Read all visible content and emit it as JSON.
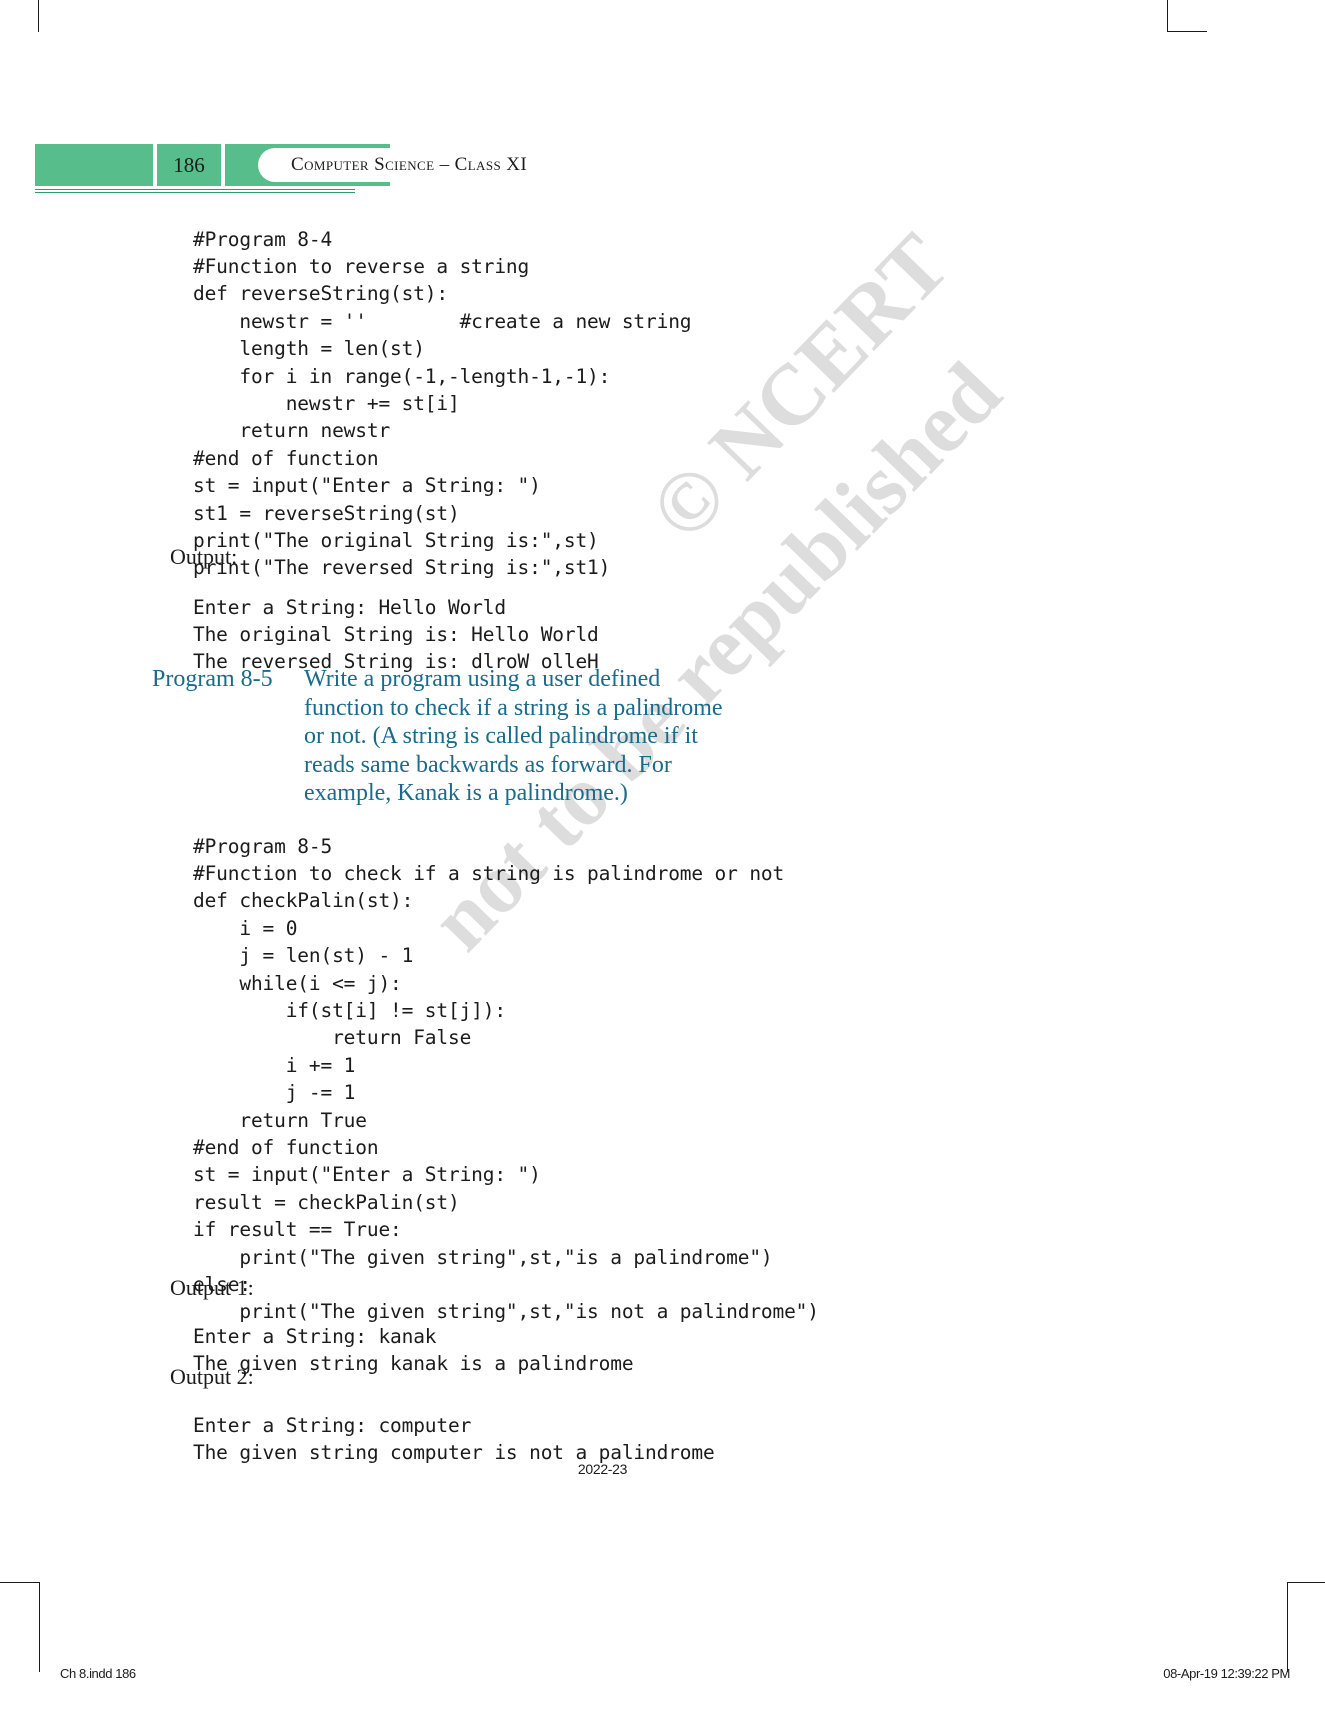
{
  "header": {
    "page_number": "186",
    "running_title": "Computer Science – Class XI",
    "accent_color": "#57bd8a"
  },
  "watermark": {
    "line1": "© NCERT",
    "line2": "not to be republished"
  },
  "body": {
    "program_8_4_code": "#Program 8-4\n#Function to reverse a string\ndef reverseString(st):\n    newstr = ''        #create a new string\n    length = len(st)\n    for i in range(-1,-length-1,-1):\n        newstr += st[i]\n    return newstr\n#end of function\nst = input(\"Enter a String: \")\nst1 = reverseString(st)\nprint(\"The original String is:\",st)\nprint(\"The reversed String is:\",st1)",
    "output_label": "Output:",
    "program_8_4_output": "Enter a String: Hello World\nThe original String is: Hello World\nThe reversed String is: dlroW olleH",
    "program_8_5_label": "Program 8-5",
    "program_8_5_statement_lines": [
      "Write a program using a user defined",
      "function to check if a string is a palindrome",
      "or not. (A string is called palindrome if it",
      "reads same backwards as forward. For",
      "example, Kanak is a palindrome.)"
    ],
    "program_8_5_code": "#Program 8-5\n#Function to check if a string is palindrome or not\ndef checkPalin(st):\n    i = 0\n    j = len(st) - 1\n    while(i <= j):\n        if(st[i] != st[j]):\n            return False\n        i += 1\n        j -= 1\n    return True\n#end of function\nst = input(\"Enter a String: \")\nresult = checkPalin(st)\nif result == True:\n    print(\"The given string\",st,\"is a palindrome\")\nelse:\n    print(\"The given string\",st,\"is not a palindrome\")",
    "output1_label": "Output 1:",
    "output1_text": "Enter a String: kanak\nThe given string kanak is a palindrome",
    "output2_label": "Output 2:",
    "output2_text": "Enter a String: computer\nThe given string computer is not a palindrome"
  },
  "footer": {
    "year": "2022-23",
    "file_info": "Ch 8.indd   186",
    "timestamp": "08-Apr-19   12:39:22 PM"
  }
}
